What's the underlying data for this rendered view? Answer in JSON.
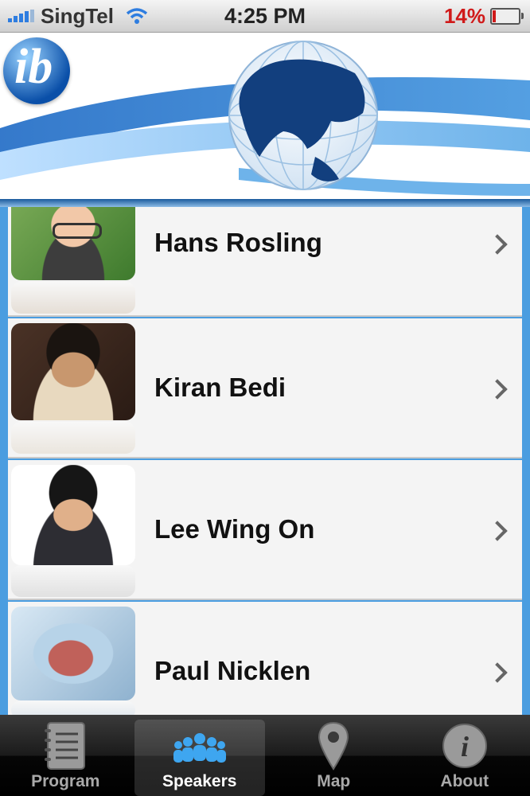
{
  "status_bar": {
    "carrier": "SingTel",
    "time": "4:25 PM",
    "battery": "14%",
    "battery_level": 0.14,
    "battery_color": "#d01a1a"
  },
  "banner": {
    "logo_text": "ib"
  },
  "speakers": [
    {
      "name": "Hans Rosling"
    },
    {
      "name": "Kiran Bedi"
    },
    {
      "name": "Lee Wing On"
    },
    {
      "name": "Paul Nicklen"
    }
  ],
  "tabs": [
    {
      "label": "Program",
      "icon": "notebook-icon",
      "selected": false
    },
    {
      "label": "Speakers",
      "icon": "people-icon",
      "selected": true
    },
    {
      "label": "Map",
      "icon": "map-pin-icon",
      "selected": false
    },
    {
      "label": "About",
      "icon": "info-icon",
      "selected": false
    }
  ],
  "colors": {
    "accent": "#4a9de0",
    "banner_blue": "#1a5a9c"
  }
}
